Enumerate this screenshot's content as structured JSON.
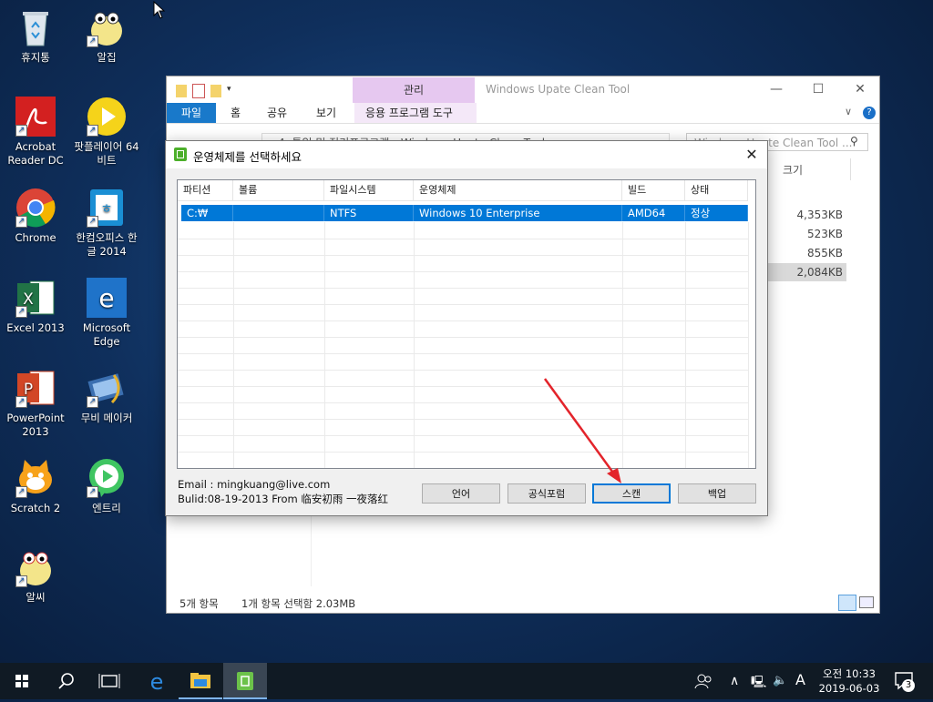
{
  "desktop": {
    "icons": [
      {
        "label": "휴지통"
      },
      {
        "label": "알집"
      },
      {
        "label": "Acrobat Reader DC"
      },
      {
        "label": "팟플레이어 64 비트"
      },
      {
        "label": "Chrome"
      },
      {
        "label": "한컴오피스 한글 2014"
      },
      {
        "label": "Excel 2013"
      },
      {
        "label": "Microsoft Edge"
      },
      {
        "label": "PowerPoint 2013"
      },
      {
        "label": "무비 메이커"
      },
      {
        "label": "Scratch 2"
      },
      {
        "label": "엔트리"
      },
      {
        "label": "알씨"
      }
    ]
  },
  "explorer": {
    "title": "Windows Upate Clean Tool",
    "context_tab": "관리",
    "tabs": [
      "파일",
      "홈",
      "공유",
      "보기",
      "응용 프로그램 도구"
    ],
    "address": "«  4. 통일 및 정리프로그램  ›  Windows Upate Clean Tool",
    "search_placeholder": "Windows Upate Clean Tool ...",
    "size_column": "크기",
    "sizes": [
      "4,353KB",
      "523KB",
      "855KB",
      "2,084KB"
    ],
    "status": {
      "items": "5개 항목",
      "selected": "1개 항목 선택함 2.03MB"
    }
  },
  "dialog": {
    "title": "운영체제를 선택하세요",
    "columns": [
      "파티션",
      "볼륨",
      "파일시스템",
      "운영체제",
      "빌드",
      "상태"
    ],
    "rows": [
      {
        "partition": "C:₩",
        "volume": "",
        "filesystem": "NTFS",
        "os": "Windows 10 Enterprise",
        "build": "AMD64",
        "status": "정상"
      }
    ],
    "email": "Email : mingkuang@live.com",
    "build_info": "Bulid:08-19-2013 From 临安初雨 一夜落红",
    "buttons": {
      "language": "언어",
      "forum": "공식포럼",
      "scan": "스캔",
      "backup": "백업"
    }
  },
  "taskbar": {
    "time": "오전 10:33",
    "date": "2019-06-03",
    "ime": "A",
    "notification_count": "3"
  },
  "colors": {
    "selection": "#0078d7",
    "file_tab": "#1979ca",
    "context_tab": "#e6c8f0",
    "arrow": "#e3242b"
  }
}
